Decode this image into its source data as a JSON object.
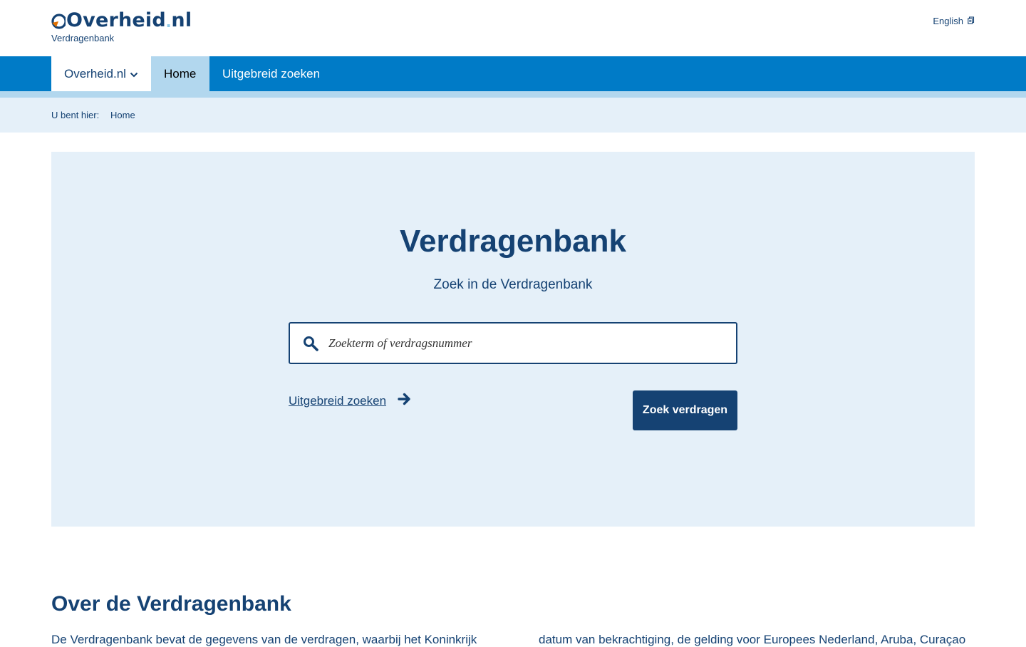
{
  "header": {
    "logo_word": "Overheid",
    "logo_dot": ".",
    "logo_tld": "nl",
    "site_name": "Verdragenbank",
    "language_link": "English",
    "language_icon": "external-link-icon"
  },
  "nav": {
    "items": [
      {
        "label": "Overheid.nl",
        "icon": "chevron-down-icon"
      },
      {
        "label": "Home"
      },
      {
        "label": "Uitgebreid zoeken"
      }
    ]
  },
  "breadcrumb": {
    "label": "U bent hier:",
    "items": [
      "Home"
    ]
  },
  "hero": {
    "title": "Verdragenbank",
    "subtitle": "Zoek in de Verdragenbank",
    "search_placeholder": "Zoekterm of verdragsnummer",
    "search_value": "",
    "advanced_link": "Uitgebreid zoeken",
    "submit_label": "Zoek verdragen"
  },
  "about": {
    "title": "Over de Verdragenbank",
    "text_left": "De Verdragenbank bevat de gegevens van de verdragen, waarbij het Koninkrijk",
    "text_right": "datum van bekrachtiging, de gelding voor Europees Nederland, Aruba, Curaçao"
  },
  "colors": {
    "primary_dark": "#154273",
    "nav_blue": "#007bc7",
    "light_blue": "#b2d7ee",
    "hero_bg": "#e5f0f9",
    "logo_orange": "#e17000"
  }
}
